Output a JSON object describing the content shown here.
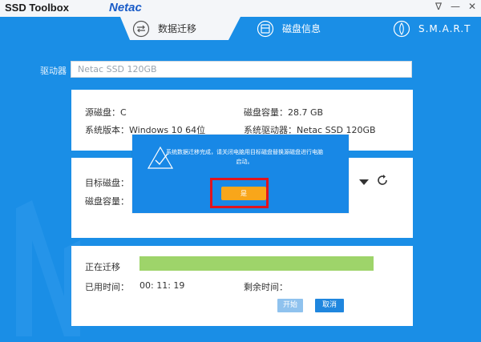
{
  "window": {
    "title": "SSD Toolbox",
    "brand": "Netac",
    "controls": [
      "∇",
      "—",
      "✕"
    ]
  },
  "tabs": [
    {
      "label": "数据迁移",
      "icon": "swap-arrows-icon",
      "active": true
    },
    {
      "label": "磁盘信息",
      "icon": "disk-icon",
      "active": false
    },
    {
      "label": "S.M.A.R.T",
      "icon": "smart-icon",
      "active": false
    }
  ],
  "drive": {
    "label": "驱动器",
    "value": "Netac SSD 120GB"
  },
  "source": {
    "disk_label": "源磁盘：C",
    "capacity_label": "磁盘容量：28.7 GB",
    "os_label": "系统版本：Windows 10 64位",
    "driver_label": "系统驱动器：Netac SSD 120GB"
  },
  "target": {
    "disk_label": "目标磁盘：",
    "capacity_label": "磁盘容量："
  },
  "progress": {
    "status_label": "正在迁移",
    "elapsed_label": "已用时间：",
    "elapsed_value": "00: 11: 19",
    "remaining_label": "剩余时间：",
    "fraction": 1.0
  },
  "buttons": {
    "start": "开始",
    "cancel": "取消"
  },
  "dialog": {
    "message": "系统数据迁移完成，请关闭电脑用目标磁盘替换源磁盘进行电脑启动。",
    "ok": "是"
  },
  "colors": {
    "background": "#1a8ee6",
    "progress": "#9ed46a",
    "ok_button": "#f9a61a",
    "highlight": "#e0141e"
  }
}
